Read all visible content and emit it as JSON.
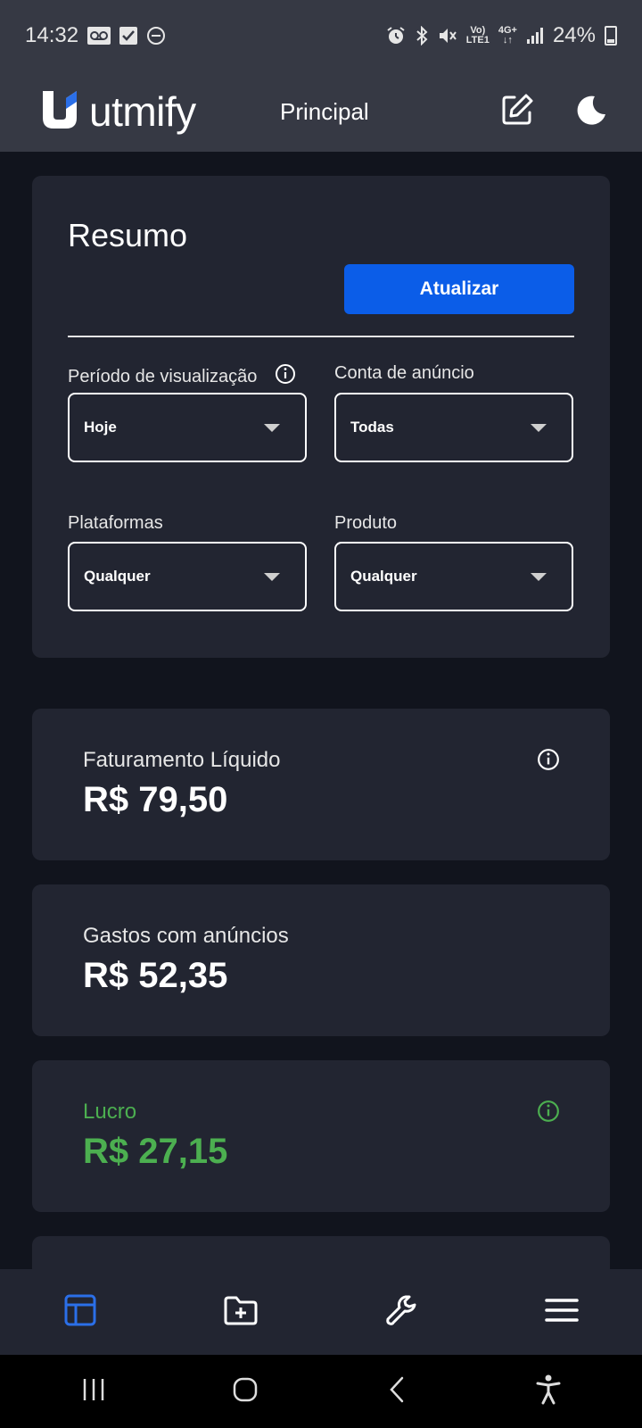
{
  "status_bar": {
    "time": "14:32",
    "network_top": "Vo)",
    "network_bottom": "LTE1",
    "gen_top": "4G+",
    "gen_bottom": "↓↑",
    "battery": "24%"
  },
  "header": {
    "logo_text": "utmify",
    "title": "Principal"
  },
  "summary": {
    "title": "Resumo",
    "update_label": "Atualizar",
    "period_label": "Período de visualização",
    "period_value": "Hoje",
    "account_label": "Conta de anúncio",
    "account_value": "Todas",
    "platforms_label": "Plataformas",
    "platforms_value": "Qualquer",
    "product_label": "Produto",
    "product_value": "Qualquer"
  },
  "metrics": [
    {
      "label": "Faturamento Líquido",
      "value": "R$ 79,50"
    },
    {
      "label": "Gastos com anúncios",
      "value": "R$ 52,35"
    },
    {
      "label": "Lucro",
      "value": "R$ 27,15"
    }
  ],
  "colors": {
    "accent": "#0b5de8",
    "profit": "#4caf50",
    "background": "#11141d",
    "card": "#222531",
    "header": "#363944"
  },
  "icons": {
    "header": [
      "edit-icon",
      "moon-icon"
    ],
    "bottom_nav": [
      "dashboard-icon",
      "folder-add-icon",
      "wrench-icon",
      "menu-icon"
    ],
    "system_nav": [
      "recents-icon",
      "home-icon",
      "back-icon",
      "accessibility-icon"
    ]
  }
}
